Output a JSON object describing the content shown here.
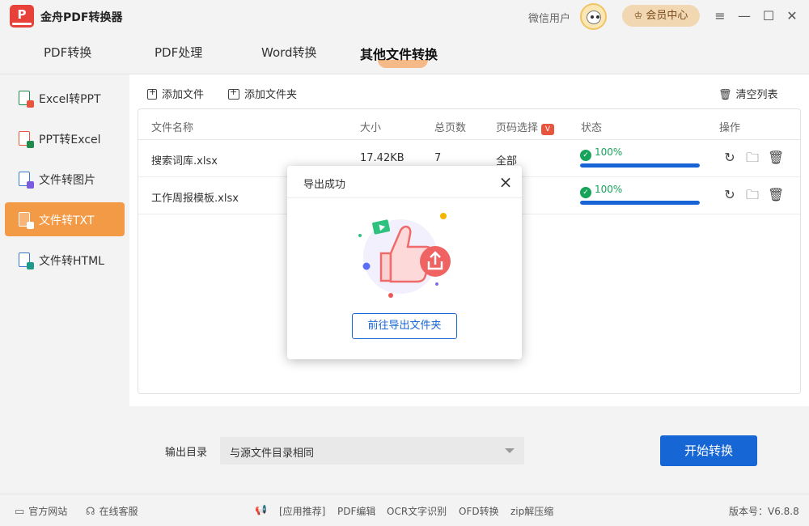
{
  "app": {
    "logo_letter": "P",
    "title": "金舟PDF转换器",
    "user_name": "微信用户",
    "vip_label": "会员中心",
    "window_controls": [
      "menu-icon",
      "minimize-icon",
      "maximize-icon",
      "close-icon"
    ]
  },
  "tabs": [
    {
      "label": "PDF转换",
      "active": false
    },
    {
      "label": "PDF处理",
      "active": false
    },
    {
      "label": "Word转换",
      "active": false
    },
    {
      "label": "其他文件转换",
      "active": true
    }
  ],
  "sidebar": {
    "items": [
      {
        "label": "Excel转PPT",
        "icon": "excel-to-ppt-icon",
        "active": false
      },
      {
        "label": "PPT转Excel",
        "icon": "ppt-to-excel-icon",
        "active": false
      },
      {
        "label": "文件转图片",
        "icon": "file-to-image-icon",
        "active": false
      },
      {
        "label": "文件转TXT",
        "icon": "file-to-txt-icon",
        "active": true
      },
      {
        "label": "文件转HTML",
        "icon": "file-to-html-icon",
        "active": false
      }
    ]
  },
  "toolbar": {
    "add_file": "添加文件",
    "add_folder": "添加文件夹",
    "clear_list": "清空列表"
  },
  "table": {
    "columns": [
      "文件名称",
      "大小",
      "总页数",
      "页码选择",
      "状态",
      "操作"
    ],
    "rows": [
      {
        "name": "搜索词库.xlsx",
        "size": "17.42KB",
        "pages": "7",
        "page_select": "全部",
        "status": "100%",
        "progress": 1.0
      },
      {
        "name": "工作周报模板.xlsx",
        "size": "",
        "pages": "",
        "page_select": "",
        "status": "100%",
        "progress": 1.0
      }
    ]
  },
  "output": {
    "label": "输出目录",
    "selected": "与源文件目录相同"
  },
  "start_button": "开始转换",
  "statusbar": {
    "website": "官方网站",
    "support": "在线客服",
    "recommend": "[应用推荐]",
    "links": [
      "PDF编辑",
      "OCR文字识别",
      "OFD转换",
      "zip解压缩"
    ],
    "version": "版本号：V6.8.8"
  },
  "dialog": {
    "title": "导出成功",
    "button": "前往导出文件夹"
  },
  "colors": {
    "accent_orange": "#f39a46",
    "primary_blue": "#1766d6",
    "success_green": "#16a35a",
    "brand_red": "#e8413a"
  }
}
